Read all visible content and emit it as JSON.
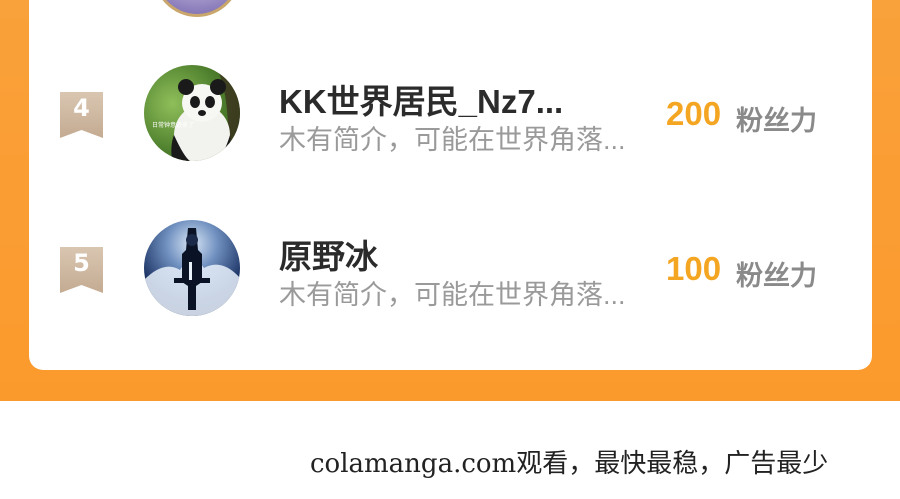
{
  "ranking": [
    {
      "rank": "4",
      "name": "KK世界居民_Nz7...",
      "intro": "木有简介，可能在世界角落...",
      "score": "200",
      "score_unit": "粉丝力",
      "avatar_icon": "panda-avatar-icon",
      "avatar_caption": "日常钟意迹来了"
    },
    {
      "rank": "5",
      "name": "原野冰",
      "intro": "木有简介，可能在世界角落...",
      "score": "100",
      "score_unit": "粉丝力",
      "avatar_icon": "dark-figure-avatar-icon"
    }
  ],
  "footer": {
    "watermark": "colamanga.com观看，最快最稳，广告最少"
  },
  "colors": {
    "background_orange": "#fb9a2c",
    "card": "#ffffff",
    "score": "#f4a623",
    "rank_badge": "#cdb79f"
  }
}
